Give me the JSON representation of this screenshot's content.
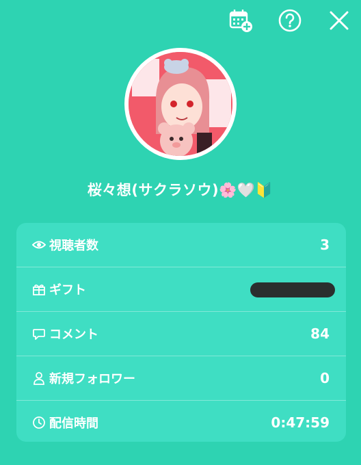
{
  "colors": {
    "background": "#2ed3b2",
    "card": "#3fdec3",
    "avatar_bg": "#f25a6a"
  },
  "toolbar": {
    "calendar_icon": "calendar-add-icon",
    "help_icon": "help-circle-icon",
    "close_icon": "close-icon"
  },
  "profile": {
    "name": "桜々想(サクラソウ)🌸🤍🔰"
  },
  "stats": [
    {
      "icon": "eye-icon",
      "label": "視聴者数",
      "value": "3"
    },
    {
      "icon": "gift-icon",
      "label": "ギフト",
      "value": "",
      "redacted": true
    },
    {
      "icon": "comment-icon",
      "label": "コメント",
      "value": "84"
    },
    {
      "icon": "person-icon",
      "label": "新規フォロワー",
      "value": "0"
    },
    {
      "icon": "clock-icon",
      "label": "配信時間",
      "value": "0:47:59"
    }
  ]
}
